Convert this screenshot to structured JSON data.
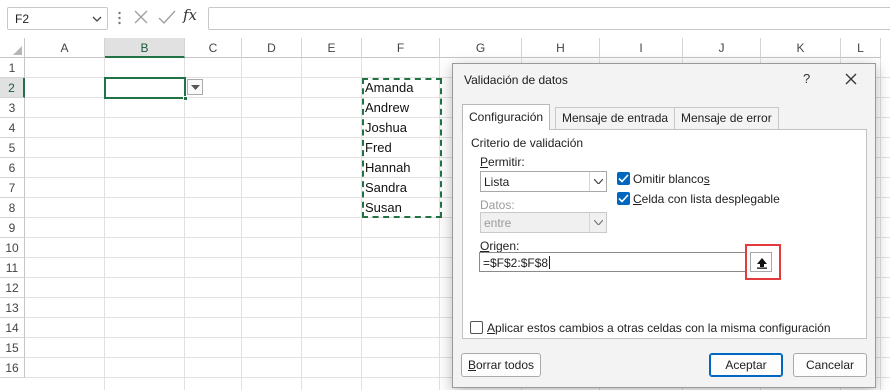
{
  "formula_bar": {
    "name_box": "F2",
    "cancel_icon": "x-icon",
    "enter_icon": "check-icon",
    "fx_label": "fx",
    "formula_value": ""
  },
  "sheet": {
    "columns": [
      "A",
      "B",
      "C",
      "D",
      "E",
      "F",
      "G",
      "H",
      "I",
      "J",
      "K",
      "L"
    ],
    "rows": [
      "1",
      "2",
      "3",
      "4",
      "5",
      "6",
      "7",
      "8",
      "9",
      "10",
      "11",
      "12",
      "13",
      "14",
      "15",
      "16"
    ],
    "selected_column": "B",
    "selected_row": "2",
    "names": [
      "Amanda",
      "Andrew",
      "Joshua",
      "Fred",
      "Hannah",
      "Sandra",
      "Susan"
    ],
    "accent_color": "#217346"
  },
  "dialog": {
    "title": "Validación de datos",
    "help": "?",
    "tabs": [
      "Configuración",
      "Mensaje de entrada",
      "Mensaje de error"
    ],
    "active_tab": "Configuración",
    "section_title": "Criterio de validación",
    "allow_label": "Permitir:",
    "allow_value": "Lista",
    "data_label": "Datos:",
    "data_value": "entre",
    "ignore_blank_label": "Omitir blancos",
    "ignore_blank_checked": true,
    "in_cell_dropdown_label": "Celda con lista desplegable",
    "in_cell_dropdown_checked": true,
    "source_label": "Origen:",
    "source_value": "=$F$2:$F$8",
    "apply_all_label": "Aplicar estos cambios a otras celdas con la misma configuración",
    "apply_all_checked": false,
    "clear_all_label": "Borrar todos",
    "ok_label": "Aceptar",
    "cancel_label": "Cancelar",
    "highlight_color": "#e33b3b",
    "checkbox_color": "#0067c0"
  }
}
